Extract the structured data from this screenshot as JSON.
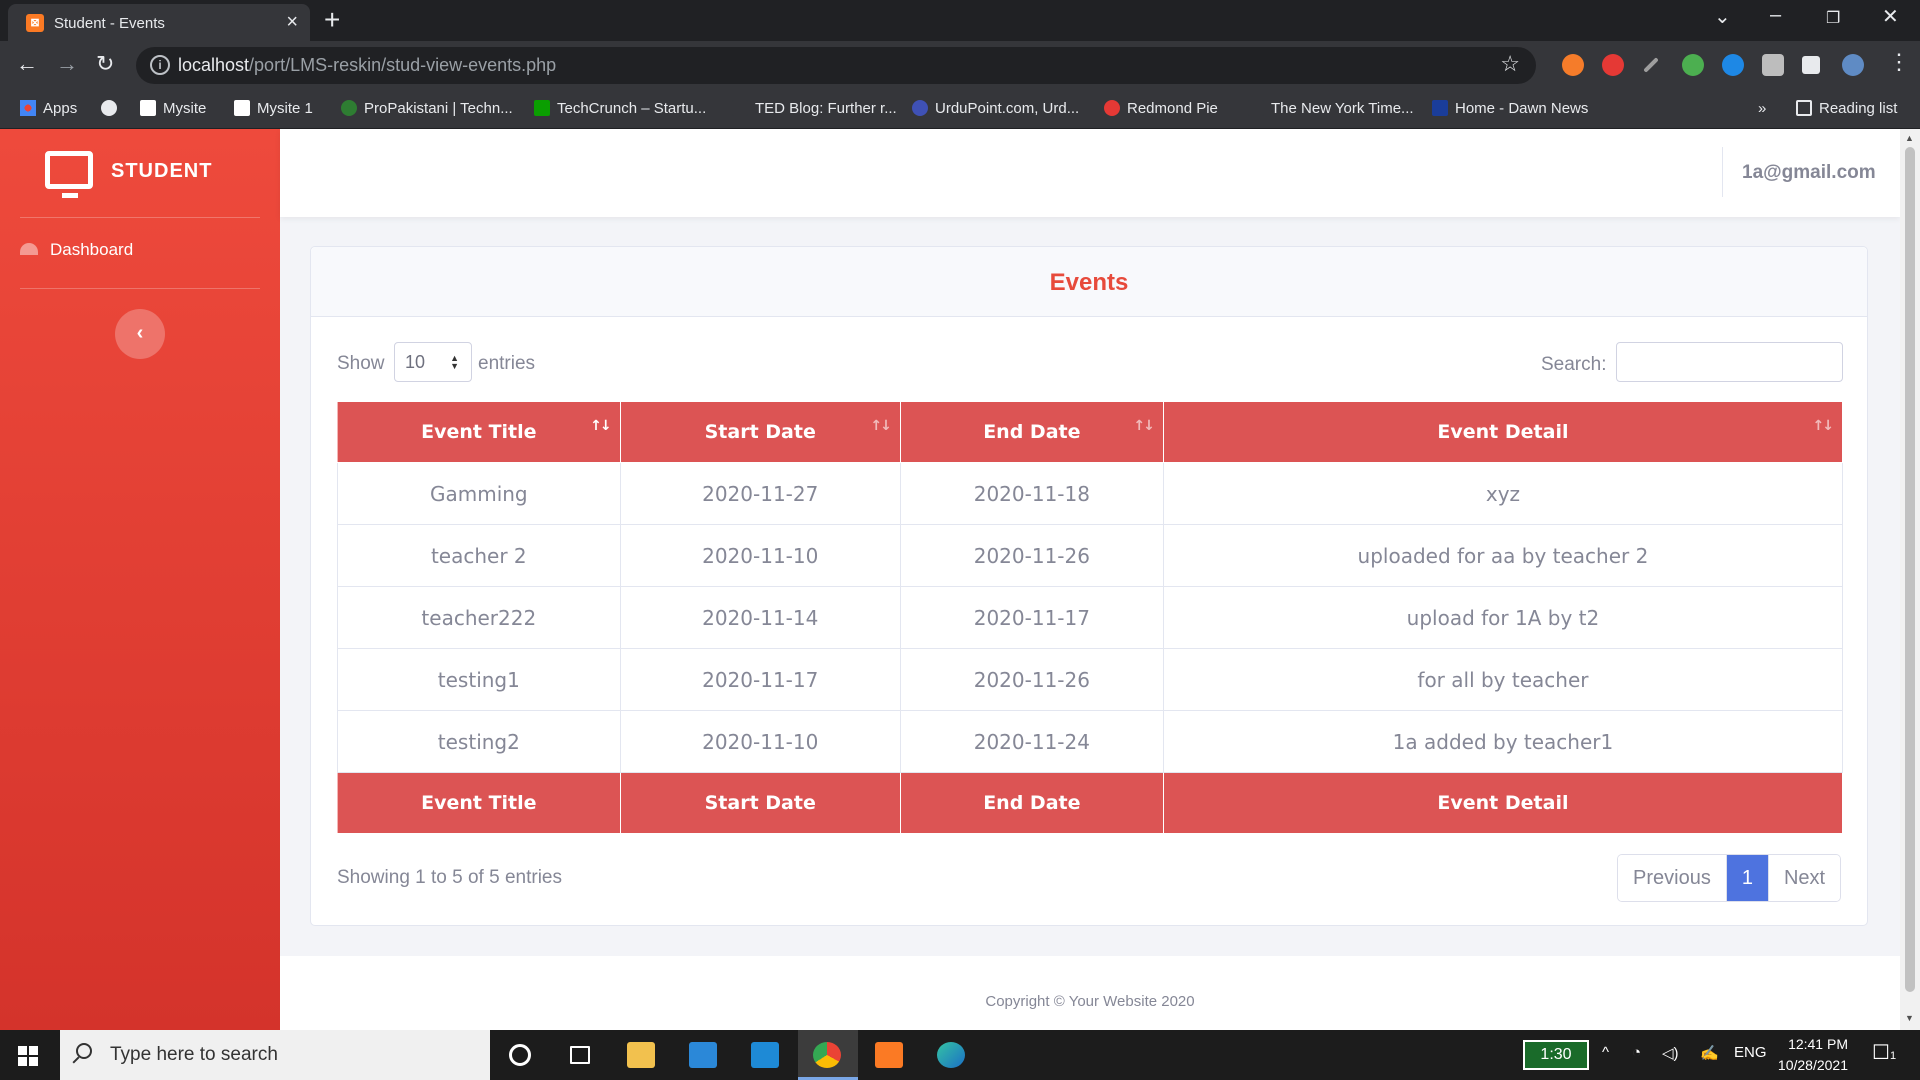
{
  "browser": {
    "tab_title": "Student - Events",
    "url_host": "localhost",
    "url_path": "/port/LMS-reskin/stud-view-events.php",
    "bookmarks": [
      "Apps",
      "Mysite",
      "Mysite 1",
      "ProPakistani | Techn...",
      "TechCrunch – Startu...",
      "TED Blog: Further r...",
      "UrduPoint.com, Urd...",
      "Redmond Pie",
      "The New York Time...",
      "Home - Dawn News"
    ],
    "overflow": "»",
    "reading_list": "Reading list"
  },
  "sidebar": {
    "brand": "STUDENT",
    "nav_dashboard": "Dashboard",
    "collapse_glyph": "‹"
  },
  "topbar": {
    "user_email": "1a@gmail.com"
  },
  "card": {
    "title": "Events",
    "show_label": "Show",
    "page_length": "10",
    "entries_label": "entries",
    "search_label": "Search:",
    "search_value": ""
  },
  "table": {
    "columns": [
      "Event Title",
      "Start Date",
      "End Date",
      "Event Detail"
    ],
    "rows": [
      [
        "Gamming",
        "2020-11-27",
        "2020-11-18",
        "xyz"
      ],
      [
        "teacher 2",
        "2020-11-10",
        "2020-11-26",
        "uploaded for aa by teacher 2"
      ],
      [
        "teacher222",
        "2020-11-14",
        "2020-11-17",
        "upload for 1A by t2"
      ],
      [
        "testing1",
        "2020-11-17",
        "2020-11-26",
        "for all by teacher"
      ],
      [
        "testing2",
        "2020-11-10",
        "2020-11-24",
        "1a added by teacher1"
      ]
    ],
    "sort_glyph": "↑↓"
  },
  "pagination": {
    "info": "Showing 1 to 5 of 5 entries",
    "previous": "Previous",
    "current": "1",
    "next": "Next"
  },
  "footer": {
    "copyright": "Copyright © Your Website 2020"
  },
  "taskbar": {
    "search_placeholder": "Type here to search",
    "battery": "1:30",
    "language": "ENG",
    "time": "12:41 PM",
    "date": "10/28/2021",
    "notification_count": "1"
  },
  "colors": {
    "sidebar": "#e74a3b",
    "table_header": "#dc5454",
    "pager_active": "#4e73df",
    "title": "#e74a3b"
  }
}
